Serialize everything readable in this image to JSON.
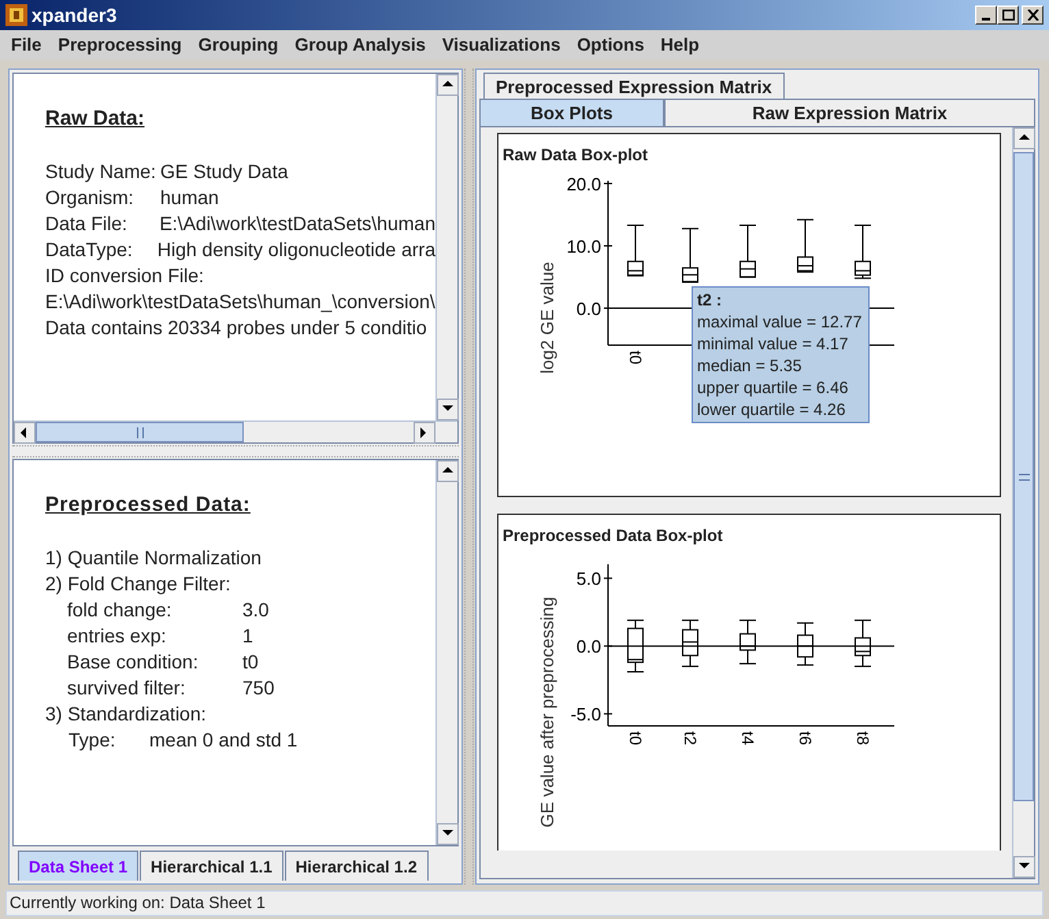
{
  "window": {
    "title": "xpander3"
  },
  "menu": [
    "File",
    "Preprocessing",
    "Grouping",
    "Group Analysis",
    "Visualizations",
    "Options",
    "Help"
  ],
  "raw_data": {
    "heading": "Raw Data:",
    "rows": [
      {
        "label": "Study Name:",
        "value": "GE Study Data"
      },
      {
        "label": "Organism:",
        "value": "human"
      },
      {
        "label": "Data File:",
        "value": "E:\\Adi\\work\\testDataSets\\human"
      },
      {
        "label": "DataType:",
        "value": "High density oligonucleotide arra"
      }
    ],
    "lines": [
      "ID conversion File:",
      "E:\\Adi\\work\\testDataSets\\human_\\conversion\\",
      "Data contains 20334 probes under 5 conditio"
    ]
  },
  "preprocessed_data": {
    "heading": "Preprocessed Data:",
    "items": [
      {
        "kind": "step",
        "text": "1) Quantile Normalization"
      },
      {
        "kind": "step",
        "text": "2) Fold Change Filter:"
      },
      {
        "kind": "param",
        "label": "fold change:",
        "value": "3.0"
      },
      {
        "kind": "param",
        "label": "entries exp:",
        "value": "1"
      },
      {
        "kind": "param",
        "label": "Base condition:",
        "value": "t0"
      },
      {
        "kind": "param",
        "label": "survived filter:",
        "value": "750"
      },
      {
        "kind": "step",
        "text": "3) Standardization:"
      },
      {
        "kind": "detail",
        "label": "Type:",
        "value": "mean 0 and std 1"
      }
    ]
  },
  "sheet_tabs": [
    {
      "label": "Data Sheet 1",
      "selected": true
    },
    {
      "label": "Hierarchical 1.1",
      "selected": false
    },
    {
      "label": "Hierarchical 1.2",
      "selected": false
    }
  ],
  "outer_tabs": [
    {
      "label": "Preprocessed Expression Matrix",
      "selected": true
    }
  ],
  "inner_tabs": [
    {
      "label": "Box Plots",
      "selected": true
    },
    {
      "label": "Raw Expression Matrix",
      "selected": false
    }
  ],
  "plots": [
    {
      "title": "Raw Data Box-plot",
      "ylabel": "log2 GE value",
      "yticks": [
        "20.0",
        "10.0",
        "0.0"
      ],
      "categories": [
        "t0"
      ]
    },
    {
      "title": "Preprocessed Data Box-plot",
      "ylabel": "GE value after preprocessing",
      "yticks": [
        "5.0",
        "0.0",
        "-5.0"
      ],
      "categories": [
        "t0",
        "t2",
        "t4",
        "t6",
        "t8"
      ]
    }
  ],
  "tooltip": {
    "title": "t2 :",
    "lines": [
      "maximal value = 12.77",
      "minimal value = 4.17",
      "median = 5.35",
      "upper quartile = 6.46",
      "lower quartile = 4.26"
    ]
  },
  "status_bar": "Currently working on: Data Sheet 1"
}
